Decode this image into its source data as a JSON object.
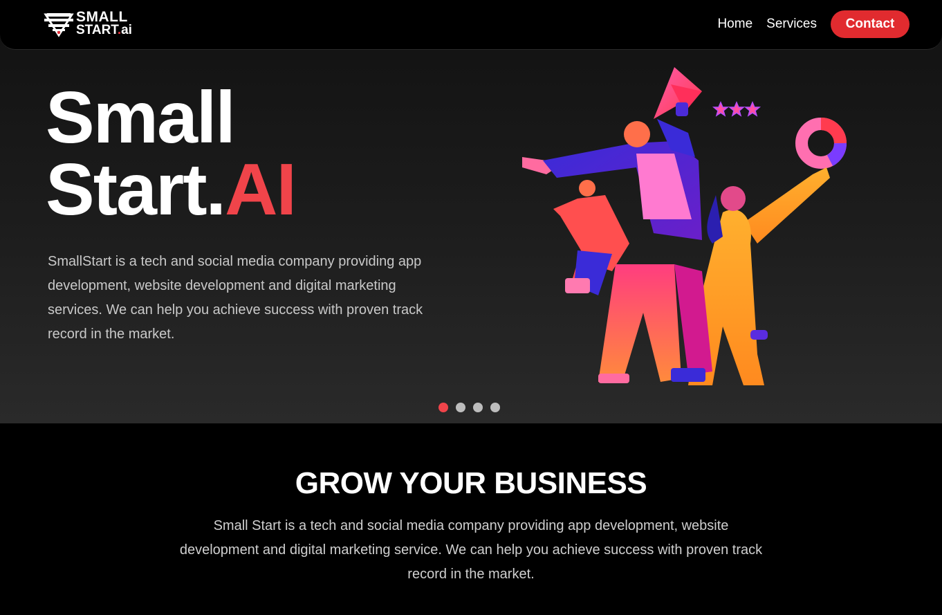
{
  "nav": {
    "logo_line1": "SMALL",
    "logo_line2_main": "START",
    "logo_line2_dot": ".",
    "logo_line2_suffix": "ai",
    "links": [
      "Home",
      "Services"
    ],
    "contact_label": "Contact"
  },
  "hero": {
    "title_line1": "Small",
    "title_line2_main": "Start.",
    "title_line2_accent": "AI",
    "description": "SmallStart is a tech and social media company providing app development, website development and digital marketing services. We can help you achieve success with proven track record in the market.",
    "carousel": {
      "slide_count": 4,
      "active_index": 0
    }
  },
  "section": {
    "title": "GROW YOUR BUSINESS",
    "description": "Small Start is a tech and social media company providing app development, website development and digital marketing service. We can help you achieve success with proven track record in the market."
  },
  "colors": {
    "accent": "#f0444a",
    "button": "#e12b2f",
    "background": "#000000"
  },
  "icons": {
    "logo": "diamond-logo-icon",
    "illustration": "team-megaphone-illustration"
  }
}
